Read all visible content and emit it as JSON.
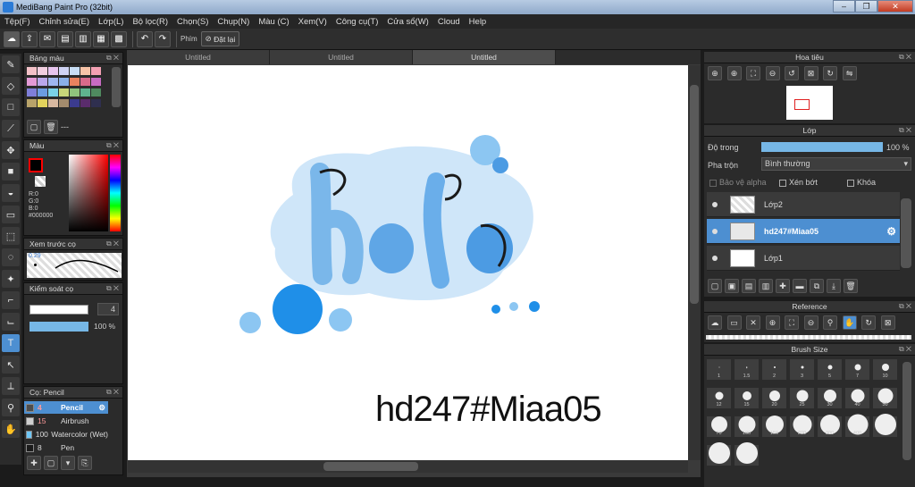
{
  "window": {
    "title": "MediBang Paint Pro (32bit)",
    "minimize": "‒",
    "maximize": "❐",
    "close": "✕"
  },
  "menu": [
    "Tệp(F)",
    "Chỉnh sửa(E)",
    "Lớp(L)",
    "Bộ lọc(R)",
    "Chọn(S)",
    "Chụp(N)",
    "Màu (C)",
    "Xem(V)",
    "Công cụ(T)",
    "Cửa sổ(W)",
    "Cloud",
    "Help"
  ],
  "toolbar": {
    "key_label": "Phím",
    "reset_label": "Đặt lại"
  },
  "tabs": [
    "Untitled",
    "Untitled",
    "Untitled"
  ],
  "palette": {
    "title": "Bảng màu",
    "footer": "---"
  },
  "color": {
    "title": "Màu",
    "r": "R:0",
    "g": "G:0",
    "b": "B:0",
    "hex": "#000000",
    "primary": "#000000",
    "accent": "#ff0000"
  },
  "brush_preview": {
    "title": "Xem trước cọ",
    "size": "0.29"
  },
  "brush_control": {
    "title": "Kiểm soát cọ",
    "size_value": "4",
    "opacity_value": "100 %"
  },
  "brush_list": {
    "title": "Cọ: Pencil",
    "items": [
      {
        "size": "4",
        "name": "Pencil",
        "color": "#4d4d4d"
      },
      {
        "size": "15",
        "name": "Airbrush",
        "color": "#cfcfcf"
      },
      {
        "size": "100",
        "name": "Watercolor (Wet)",
        "color": "#6ec6f5"
      },
      {
        "size": "8",
        "name": "Pen",
        "color": "#1b1b1b"
      }
    ]
  },
  "canvas": {
    "signature": "hd247#Miaa05"
  },
  "navigator": {
    "title": "Hoa tiêu"
  },
  "layers": {
    "title": "Lớp",
    "opacity_label": "Độ trong",
    "opacity_value": "100 %",
    "blend_label": "Pha trộn",
    "blend_value": "Bình thường",
    "alpha_label": "Bảo vệ alpha",
    "clip_label": "Xén bớt",
    "lock_label": "Khóa",
    "items": [
      "Lớp2",
      "hd247#Miaa05",
      "Lớp1"
    ]
  },
  "reference": {
    "title": "Reference"
  },
  "brush_size": {
    "title": "Brush Size",
    "sizes": [
      "1",
      "1.5",
      "2",
      "3",
      "5",
      "7",
      "10",
      "12",
      "15",
      "20",
      "25",
      "30",
      "40",
      "50",
      "70",
      "100",
      "150",
      "200",
      "300",
      "400",
      "",
      "",
      ""
    ]
  }
}
